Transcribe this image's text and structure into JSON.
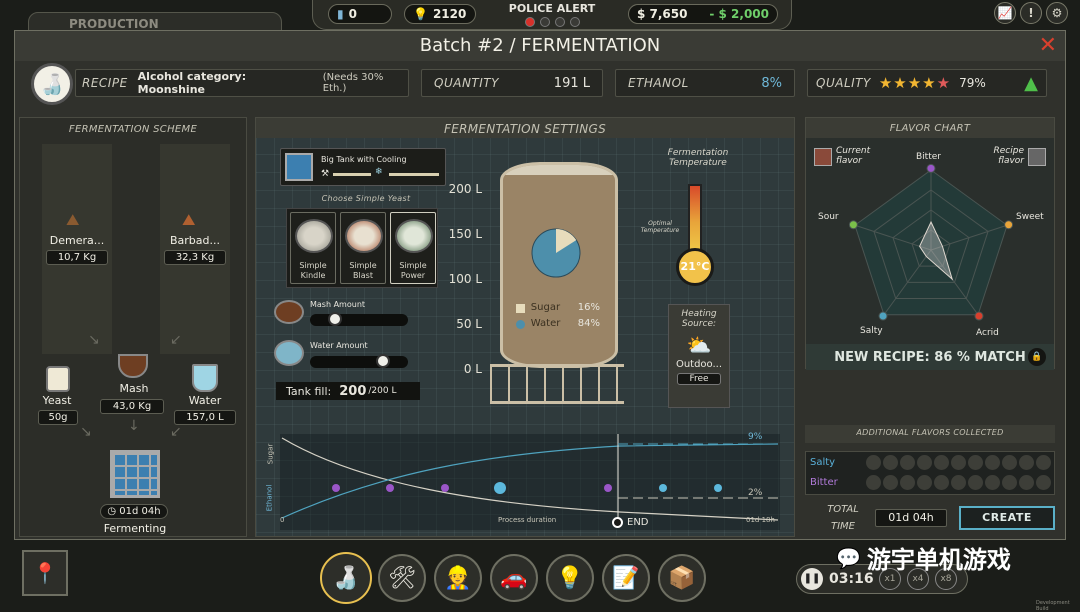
{
  "hud": {
    "bg_tab_label": "PRODUCTION",
    "bottle_count": "0",
    "bulbs": "2120",
    "police_alert": "POLICE ALERT",
    "cash": "$ 7,650",
    "debt": "- $ 2,000"
  },
  "window": {
    "title": "Batch #2 / FERMENTATION",
    "close": "✕"
  },
  "info": {
    "recipe_label": "RECIPE",
    "recipe_value": "Alcohol category: Moonshine",
    "recipe_note": "(Needs 30% Eth.)",
    "quantity_label": "QUANTITY",
    "quantity_value": "191 L",
    "ethanol_label": "ETHANOL",
    "ethanol_value": "8%",
    "quality_label": "QUALITY",
    "quality_value": "79%",
    "quality_stars": 4.5
  },
  "scheme": {
    "title": "FERMENTATION SCHEME",
    "demerara_label": "Demera...",
    "demerara_value": "10,7 Kg",
    "barbados_label": "Barbad...",
    "barbados_value": "32,3 Kg",
    "yeast_label": "Yeast",
    "yeast_value": "50g",
    "mash_label": "Mash",
    "mash_value": "43,0 Kg",
    "water_label": "Water",
    "water_value": "157,0 L",
    "timer": "01d 04h",
    "status": "Fermenting"
  },
  "settings": {
    "title": "FERMENTATION SETTINGS",
    "tank_name": "Big Tank with Cooling",
    "yeast_prompt": "Choose Simple Yeast",
    "yeasts": [
      "Simple Kindle",
      "Simple Blast",
      "Simple Power"
    ],
    "mash_amount_label": "Mash Amount",
    "water_amount_label": "Water Amount",
    "mash_fraction": 0.22,
    "water_fraction": 0.78,
    "tank_fill_label": "Tank fill:",
    "tank_fill_value": "200",
    "tank_fill_max": "/200 L",
    "axis": [
      "200 L",
      "150 L",
      "100 L",
      "50 L",
      "0 L"
    ],
    "sugar_label": "Sugar",
    "sugar_pct": "16%",
    "water_label": "Water",
    "water_pct": "84%",
    "sugar_fraction": 0.16,
    "ferm_temp_label": "Fermentation Temperature",
    "optimal_label": "Optimal Temperature",
    "temp_value": "21°C",
    "heating_label": "Heating Source:",
    "heating_value": "Outdoo...",
    "heating_cost": "Free"
  },
  "graph": {
    "sugar_axis": "Sugar",
    "ethanol_axis": "Ethanol",
    "x_start": "0",
    "x_label": "Process duration",
    "x_end": "01d 18h",
    "end_label": "END",
    "ethanol_end": "9%",
    "sugar_end": "2%"
  },
  "flavor": {
    "title": "FLAVOR CHART",
    "current_label": "Current flavor",
    "recipe_label": "Recipe flavor",
    "axes": [
      "Bitter",
      "Sweet",
      "Acrid",
      "Salty",
      "Sour"
    ],
    "current_values": [
      0.35,
      0.15,
      0.45,
      0.1,
      0.15
    ],
    "match": "NEW RECIPE: 86 % MATCH",
    "additional_title": "ADDITIONAL FLAVORS COLLECTED",
    "salty_label": "Salty",
    "bitter_label": "Bitter",
    "total_time_label": "TOTAL TIME",
    "total_time_value": "01d 04h",
    "create_label": "CREATE"
  },
  "bottom": {
    "clock": "03:16",
    "speeds": [
      "x1",
      "x4",
      "x8"
    ],
    "watermark": "游宇单机游戏",
    "build_note": "Development Build"
  },
  "colors": {
    "accent_teal": "#4fa3bf",
    "sugar": "#e7dcbc",
    "water": "#4d8fab",
    "danger": "#d8402e",
    "money_green": "#6fcf6a",
    "star": "#f2b632"
  }
}
